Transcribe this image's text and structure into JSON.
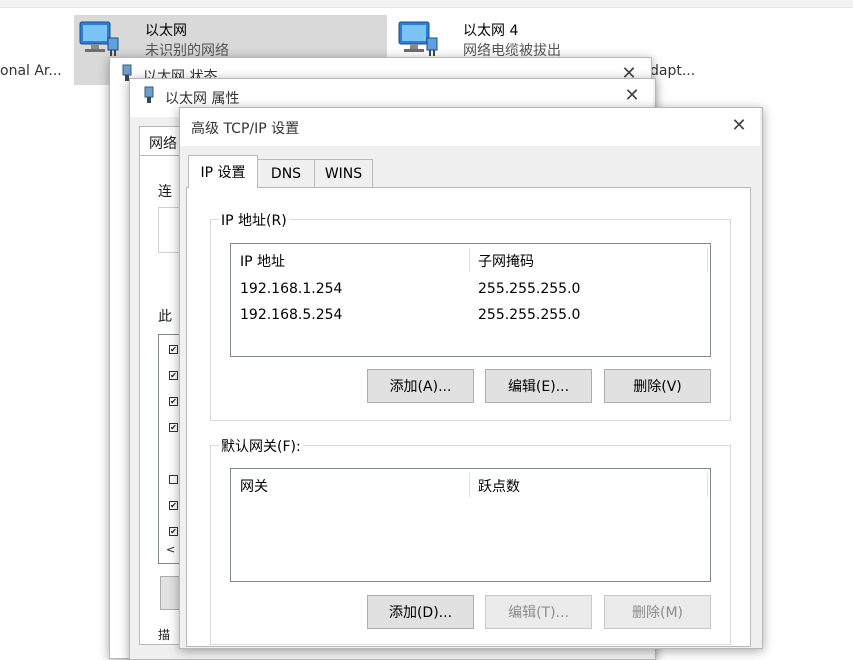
{
  "background_window": {
    "left_truncated_text": "onal Ar...",
    "right_truncated_text": "dapt...",
    "adapters": [
      {
        "name": "以太网",
        "status": "未识别的网络",
        "selected": true
      },
      {
        "name": "以太网 4",
        "status": "网络电缆被拔出",
        "selected": false
      }
    ]
  },
  "status_dialog": {
    "title": "以太网 状态"
  },
  "properties_dialog": {
    "title": "以太网 属性",
    "tab_label": "网络",
    "connect_label": "连",
    "this_label": "此",
    "checkbox_states": [
      true,
      true,
      true,
      true,
      false,
      true,
      true
    ],
    "scroll_arrow": "<"
  },
  "advanced_dialog": {
    "title": "高级 TCP/IP 设置",
    "tabs": [
      {
        "label": "IP 设置",
        "active": true
      },
      {
        "label": "DNS",
        "active": false
      },
      {
        "label": "WINS",
        "active": false
      }
    ],
    "ip_group": {
      "legend": "IP 地址(R)",
      "columns": [
        "IP 地址",
        "子网掩码"
      ],
      "rows": [
        [
          "192.168.1.254",
          "255.255.255.0"
        ],
        [
          "192.168.5.254",
          "255.255.255.0"
        ]
      ],
      "buttons": {
        "add": "添加(A)...",
        "edit": "编辑(E)...",
        "delete": "删除(V)"
      }
    },
    "gateway_group": {
      "legend": "默认网关(F):",
      "columns": [
        "网关",
        "跃点数"
      ],
      "rows": [],
      "buttons": {
        "add": "添加(D)...",
        "edit": "编辑(T)...",
        "delete": "删除(M)"
      }
    }
  },
  "icons": {
    "close": "close-icon",
    "network_adapter": "network-adapter-icon",
    "dialog_adapter": "adapter-plug-icon"
  },
  "colors": {
    "selection": "#d9d9d9",
    "dialog_bg": "#f0f0f0",
    "button_bg": "#e1e1e1",
    "disabled_text": "#8c8c8c"
  }
}
